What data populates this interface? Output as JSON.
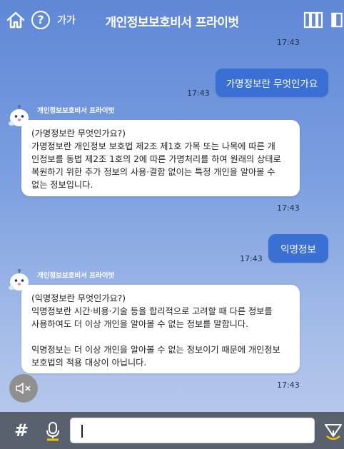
{
  "header": {
    "title": "개인정보보호비서 프라이벗",
    "font_size_label": "가가"
  },
  "messages": {
    "time_top": "17:43",
    "user1": {
      "text": "가명정보란 무엇인가요",
      "time": "17:43"
    },
    "bot1": {
      "name": "개인정보보호비서 프라이벗",
      "lines": [
        "(가명정보란 무엇인가요?)",
        "가명정보란 개인정보 보호법 제2조 제1호 가목 또는 나목에 따른 개",
        "인정보를 동법 제2조 1호의 2에 따른 가명처리를 하여 원래의 상태로",
        "복원하기 위한 추가 정보의 사용·결합 없이는 특정 개인을 알아볼 수",
        "없는 정보입니다."
      ],
      "time": "17:43"
    },
    "user2": {
      "text": "익명정보",
      "time": "17:43"
    },
    "bot2": {
      "name": "개인정보보호비서 프라이벗",
      "lines": [
        "(익명정보란 무엇인가요?)",
        "익명정보란 시간·비용·기술 등을 합리적으로 고려할 때 다른 정보를",
        "사용하여도 더 이상 개인을 알아볼 수 없는 정보를 말합니다.",
        "",
        "익명정보는 더 이상 개인을 알아볼 수 없는 정보이기 때문에 개인정보",
        "보호법의 적용 대상이 아닙니다."
      ],
      "time": "17:43"
    }
  },
  "bottom_bar": {
    "hash_label": "#",
    "input_value": ""
  },
  "colors": {
    "user_bubble": "#3a6fd4",
    "bottom_bar": "#59606e",
    "mic_accent": "#f5c400"
  }
}
